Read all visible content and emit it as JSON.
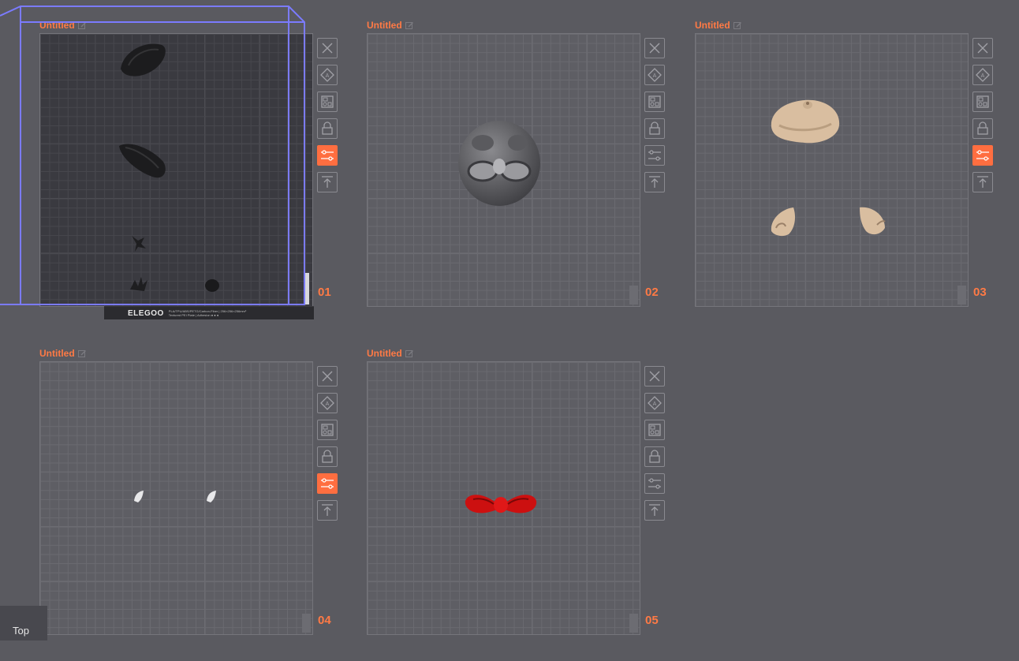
{
  "plates": [
    {
      "title": "Untitled",
      "number": "01",
      "active": true,
      "footer": {
        "brand": "ELEGOO",
        "line1": "PLA/TPU/ABS/PETG/Carbon-Fiber | 256×256×256mm³",
        "line2": "Textured PEI Plate | Adhesion ● ● ●"
      }
    },
    {
      "title": "Untitled",
      "number": "02",
      "active": false
    },
    {
      "title": "Untitled",
      "number": "03",
      "active": false
    },
    {
      "title": "Untitled",
      "number": "04",
      "active": false
    },
    {
      "title": "Untitled",
      "number": "05",
      "active": false
    }
  ],
  "toolbar_icons": [
    "close-icon",
    "auto-orient-icon",
    "arrange-icon",
    "lock-icon",
    "plate-settings-icon",
    "move-to-top-icon"
  ],
  "colors": {
    "accent": "#ff6e40",
    "selection_box": "#7b7bff",
    "background": "#5a5a60"
  },
  "view_label": "Top"
}
